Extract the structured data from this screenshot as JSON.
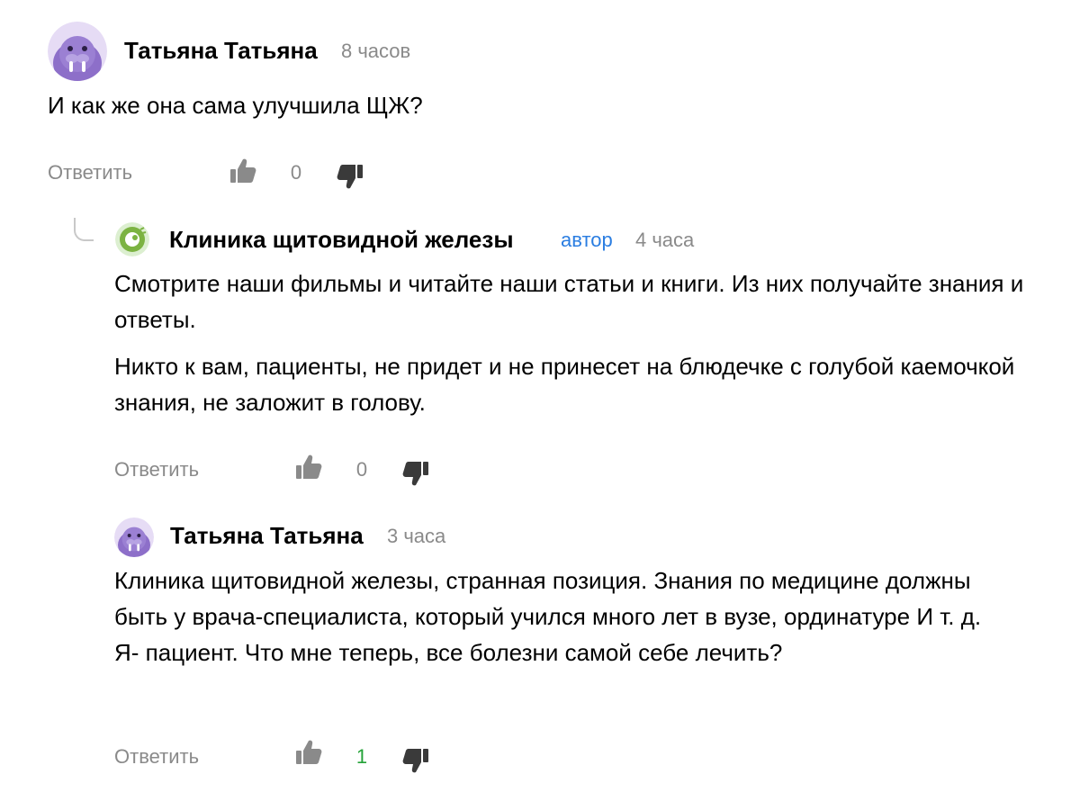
{
  "comments": [
    {
      "author": "Татьяна Татьяна",
      "time": "8 часов",
      "avatar_icon": "walrus-avatar-icon",
      "paragraphs": [
        "И как же она сама улучшила ЩЖ?"
      ],
      "reply_label": "Ответить",
      "likes": "0"
    },
    {
      "author": "Клиника щитовидной железы",
      "author_badge": "автор",
      "time": "4 часа",
      "avatar_icon": "clinic-logo-icon",
      "paragraphs": [
        "Смотрите наши фильмы и читайте наши статьи и книги. Из них получайте знания и ответы.",
        "Никто к вам, пациенты, не придет и не принесет на блюдечке с голубой каемочкой знания, не заложит в голову."
      ],
      "reply_label": "Ответить",
      "likes": "0"
    },
    {
      "author": "Татьяна Татьяна",
      "time": "3 часа",
      "avatar_icon": "walrus-avatar-icon",
      "paragraphs": [
        "Клиника щитовидной железы, странная позиция. Знания по медицине должны быть у врача-специалиста, который учился много лет в вузе, ординатуре И т. д. Я- пациент. Что мне теперь, все болезни самой себе лечить?"
      ],
      "reply_label": "Ответить",
      "likes": "1"
    }
  ],
  "colors": {
    "meta_gray": "#8a8a8a",
    "author_badge_blue": "#2a7de1",
    "positive_score_green": "#25a339",
    "avatar_purple": "#8d6fc9",
    "avatar_bg": "#e6dcf5",
    "clinic_green": "#7cb342"
  }
}
